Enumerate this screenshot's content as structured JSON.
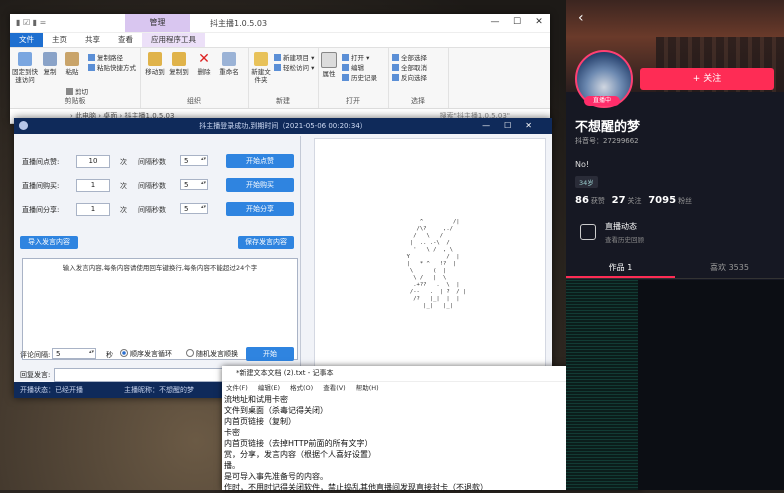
{
  "explorer": {
    "manage_tab": "管理",
    "title_path": "抖主播1.0.5.03",
    "tabs": [
      "文件",
      "主页",
      "共享",
      "查看",
      "应用程序工具"
    ],
    "ribbon": {
      "pin_label": "固定到快速访问",
      "copy_label": "复制",
      "paste_label": "粘贴",
      "copy_path": "复制路径",
      "paste_shortcut": "粘贴快捷方式",
      "cut": "剪切",
      "clipboard_group": "剪贴板",
      "move_to": "移动到",
      "copy_to": "复制到",
      "delete": "删除",
      "rename": "重命名",
      "organize_group": "组织",
      "new_folder": "新建文件夹",
      "new_item": "新建项目 ▾",
      "easy_access": "轻松访问 ▾",
      "new_group": "新建",
      "properties": "属性",
      "open": "打开 ▾",
      "edit": "编辑",
      "history": "历史记录",
      "open_group": "打开",
      "select_all": "全部选择",
      "select_none": "全部取消",
      "invert": "反向选择",
      "select_group": "选择"
    },
    "address": "› 此电脑 › 桌面 › 抖主播1.0.5.03",
    "search_placeholder": "搜索\"抖主播1.0.5.03\""
  },
  "app": {
    "title": "抖主播登录成功,到期时间（2021-05-06 00:20:34）",
    "rows": [
      {
        "label": "直播间点赞:",
        "count": "10",
        "unit": "次",
        "interval_label": "间隔秒数",
        "interval": "5",
        "button": "开始点赞"
      },
      {
        "label": "直播间购买:",
        "count": "1",
        "unit": "次",
        "interval_label": "间隔秒数",
        "interval": "5",
        "button": "开始购买"
      },
      {
        "label": "直播间分享:",
        "count": "1",
        "unit": "次",
        "interval_label": "间隔秒数",
        "interval": "5",
        "button": "开始分享"
      }
    ],
    "import_button": "导入发言内容",
    "save_button": "保存发言内容",
    "textbox_hint": "输入发言内容,每条内容请使用回车键换行,每条内容不能超过24个字",
    "comment_interval_label": "评论间隔:",
    "comment_interval": "5",
    "seconds": "秒",
    "order_label": "顺序发言循环",
    "random_label": "随机发言顺换",
    "start_button": "开始",
    "reply_label": "回复发言:",
    "status_left": "开播状态：已经开播",
    "status_anchor": "主播昵称：不想醒的梦",
    "ascii_art": "      ^         /|\n     /\\?     ,./\n    /   \\   /\n   |  .. .-\\  /\n    '   \\ /  , \\\n  Y           /  |\n  |   * ^   !?  |\n   \\      (  |\n    \\ /   |  \\\n    .+??   .  \\  |\n   /--   .  | ?  / |\n    /?   |_|  |  |\n       |_|   |_|"
  },
  "notepad": {
    "title": "*新建文本文档 (2).txt - 记事本",
    "menu": [
      "文件(F)",
      "编辑(E)",
      "格式(O)",
      "查看(V)",
      "帮助(H)"
    ],
    "lines": [
      "流地址和试用卡密",
      "文件到桌面（杀毒记得关闭）",
      "内首页链接（复制）",
      "卡密",
      "内首页链接（去掉HTTP前面的所有文字）",
      "赏，分享，发言内容（根据个人喜好设置）",
      "播。",
      "是可导入事先准备号的内容。",
      "作时，不用时记得关闭软件，禁止捣乱其他直播间发现直接封卡（不退款）"
    ]
  },
  "douyin": {
    "live_badge": "直播中",
    "follow_button": "+ 关注",
    "name": "不想醒的梦",
    "id_label": "抖音号：27299662",
    "bio": "No!",
    "tag": "34岁",
    "likes": "86",
    "likes_label": "获赞",
    "following": "27",
    "following_label": "关注",
    "fans": "7095",
    "fans_label": "粉丝",
    "dynamic_title": "直播动态",
    "dynamic_sub": "查看历史回顾",
    "tab_works": "作品 1",
    "tab_likes": "喜欢 3535"
  }
}
